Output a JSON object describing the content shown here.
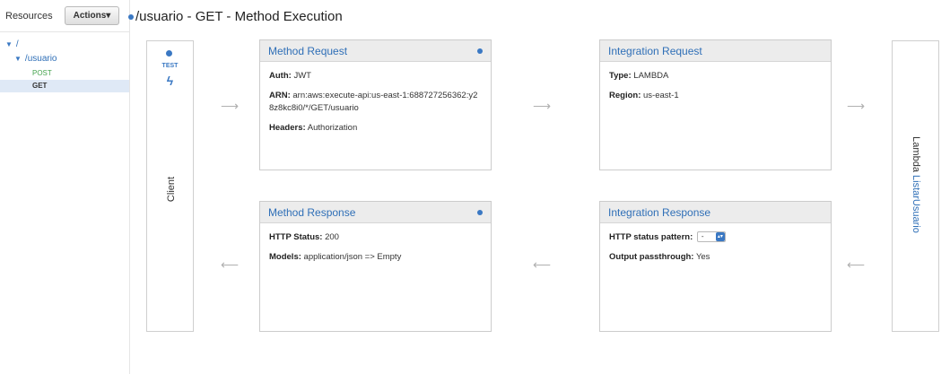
{
  "sidebar": {
    "resources_label": "Resources",
    "actions_label": "Actions▾",
    "tree": {
      "root_label": "/",
      "usuario_label": "/usuario",
      "methods": [
        "POST",
        "GET"
      ]
    }
  },
  "page": {
    "title": "/usuario - GET - Method Execution"
  },
  "client": {
    "test_label": "TEST",
    "test_icon": "lightning-icon",
    "label": "Client"
  },
  "lambda": {
    "prefix": "Lambda",
    "function_name": "ListarUsuario"
  },
  "method_request": {
    "title": "Method Request",
    "auth_key": "Auth:",
    "auth_val": "JWT",
    "arn_key": "ARN:",
    "arn_val": "arn:aws:execute-api:us-east-1:688727256362:y28z8kc8i0/*/GET/usuario",
    "headers_key": "Headers:",
    "headers_val": "Authorization"
  },
  "integration_request": {
    "title": "Integration Request",
    "type_key": "Type:",
    "type_val": "LAMBDA",
    "region_key": "Region:",
    "region_val": "us-east-1"
  },
  "method_response": {
    "title": "Method Response",
    "status_key": "HTTP Status:",
    "status_val": "200",
    "models_key": "Models:",
    "models_val": "application/json => Empty"
  },
  "integration_response": {
    "title": "Integration Response",
    "pattern_key": "HTTP status pattern:",
    "pattern_val": "-",
    "passthrough_key": "Output passthrough:",
    "passthrough_val": "Yes"
  },
  "arrows": {
    "right": "⟶",
    "left": "⟵"
  },
  "colors": {
    "link_blue": "#2f6fb7",
    "post_green": "#44a34d",
    "selected_bg": "#dfe9f6",
    "card_header_bg": "#ececec"
  }
}
